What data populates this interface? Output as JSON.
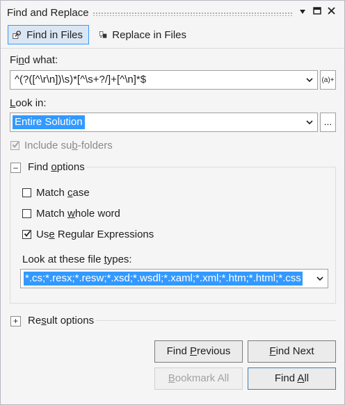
{
  "window": {
    "title": "Find and Replace",
    "buttons": [
      {
        "name": "dropdown-arrow-icon",
        "glyph": "▼"
      },
      {
        "name": "maximize-icon",
        "glyph": "▣"
      },
      {
        "name": "close-icon",
        "glyph": "✕"
      }
    ]
  },
  "tabs": [
    {
      "label": "Find in Files",
      "icon": "find-in-files-icon",
      "active": true
    },
    {
      "label": "Replace in Files",
      "icon": "replace-in-files-icon",
      "active": false
    }
  ],
  "find_what": {
    "label_pre": "Fi",
    "label_ul": "n",
    "label_post": "d what:",
    "value": "^(?([^\\r\\n])\\s)*[^\\s+?/]+[^\\n]*$",
    "regex_button": "(a)+"
  },
  "look_in": {
    "label_pre": "",
    "label_ul": "L",
    "label_post": "ook in:",
    "value": "Entire Solution",
    "browse_button": "..."
  },
  "include_subfolders": {
    "label_pre": "Include su",
    "label_ul": "b",
    "label_post": "-folders",
    "checked": true
  },
  "find_options": {
    "expander": "–",
    "label_pre": "Find ",
    "label_ul": "o",
    "label_post": "ptions",
    "match_case": {
      "label_pre": "Match ",
      "label_ul": "c",
      "label_post": "ase",
      "checked": false
    },
    "match_whole_word": {
      "label_pre": "Match ",
      "label_ul": "w",
      "label_post": "hole word",
      "checked": false
    },
    "use_regex": {
      "label_pre": "Us",
      "label_ul": "e",
      "label_post": " Regular Expressions",
      "checked": true
    },
    "file_types_label_pre": "Look at these file ",
    "file_types_label_ul": "t",
    "file_types_label_post": "ypes:",
    "file_types_value": "*.cs;*.resx;*.resw;*.xsd;*.wsdl;*.xaml;*.xml;*.htm;*.html;*.css"
  },
  "result_options": {
    "expander": "+",
    "label_pre": "Re",
    "label_ul": "s",
    "label_post": "ult options"
  },
  "buttons": {
    "find_previous": {
      "pre": "Find ",
      "ul": "P",
      "post": "revious"
    },
    "find_next": {
      "pre": "",
      "ul": "F",
      "post": "ind Next"
    },
    "bookmark_all": {
      "pre": "",
      "ul": "B",
      "post": "ookmark All"
    },
    "find_all": {
      "pre": "Find ",
      "ul": "A",
      "post": "ll"
    }
  }
}
